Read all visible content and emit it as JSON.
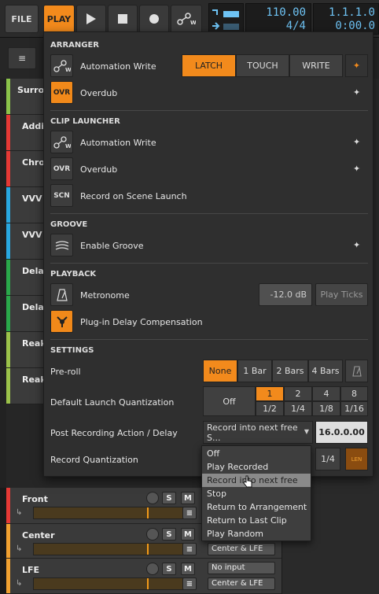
{
  "toolbar": {
    "file_label": "FILE",
    "play_label": "PLAY",
    "tempo": "110.00",
    "time_signature": "4/4",
    "position": "1.1.1.0",
    "time": "0:00.0"
  },
  "tracks": [
    {
      "name": "Surrou",
      "color": "#8bc34a"
    },
    {
      "name": "Addic",
      "color": "#e53935"
    },
    {
      "name": "Chron",
      "color": "#e53935"
    },
    {
      "name": "VVV F",
      "color": "#29a8e0"
    },
    {
      "name": "VVV F",
      "color": "#29a8e0"
    },
    {
      "name": "Delay",
      "color": "#2aa84a"
    },
    {
      "name": "Delay",
      "color": "#2aa84a"
    },
    {
      "name": "Reak",
      "color": "#9bc24a"
    },
    {
      "name": "Reak",
      "color": "#9bc24a"
    }
  ],
  "lower_tracks": [
    {
      "name": "Front",
      "color": "#e53935",
      "m": "M",
      "s": "S"
    },
    {
      "name": "Center",
      "color": "#f0a030",
      "m": "M",
      "s": "S",
      "routing": "Center & LFE"
    },
    {
      "name": "LFE",
      "color": "#f0a030",
      "m": "M",
      "s": "S",
      "input": "No input",
      "routing": "Center & LFE"
    }
  ],
  "popup": {
    "arranger": {
      "title": "ARRANGER",
      "automation_write": "Automation Write",
      "modes": [
        "LATCH",
        "TOUCH",
        "WRITE"
      ],
      "active_mode": "LATCH",
      "overdub": "Overdub",
      "ovr_icon": "OVR"
    },
    "clip_launcher": {
      "title": "CLIP LAUNCHER",
      "automation_write": "Automation Write",
      "overdub": "Overdub",
      "ovr_icon": "OVR",
      "record_scene": "Record on Scene Launch",
      "scn_icon": "SCN"
    },
    "groove": {
      "title": "GROOVE",
      "enable": "Enable Groove"
    },
    "playback": {
      "title": "PLAYBACK",
      "metronome": "Metronome",
      "metronome_level": "-12.0 dB",
      "play_ticks": "Play Ticks",
      "pdc": "Plug-in Delay Compensation"
    },
    "settings": {
      "title": "SETTINGS",
      "preroll_label": "Pre-roll",
      "preroll_options": [
        "None",
        "1 Bar",
        "2 Bars",
        "4 Bars"
      ],
      "preroll_active": "None",
      "launch_quant_label": "Default Launch Quantization",
      "launch_quant_off": "Off",
      "launch_quant_top": [
        "1",
        "2",
        "4",
        "8"
      ],
      "launch_quant_bottom": [
        "1/2",
        "1/4",
        "1/8",
        "1/16"
      ],
      "launch_quant_active": "1",
      "post_rec_label": "Post Recording Action / Delay",
      "post_rec_value": "Record into next free S...",
      "post_rec_delay": "16.0.0.00",
      "rec_quant_label": "Record Quantization",
      "rec_quant_value": "1/4",
      "len_icon": "LEN"
    }
  },
  "dropdown": {
    "items": [
      "Off",
      "Play Recorded",
      "Record into next free Slot",
      "Stop",
      "Return to Arrangement",
      "Return to Last Clip",
      "Play Random"
    ],
    "highlighted": "Record into next free Slot"
  },
  "colors": {
    "accent": "#f28a1c",
    "lcd_text": "#6ec3f4"
  }
}
